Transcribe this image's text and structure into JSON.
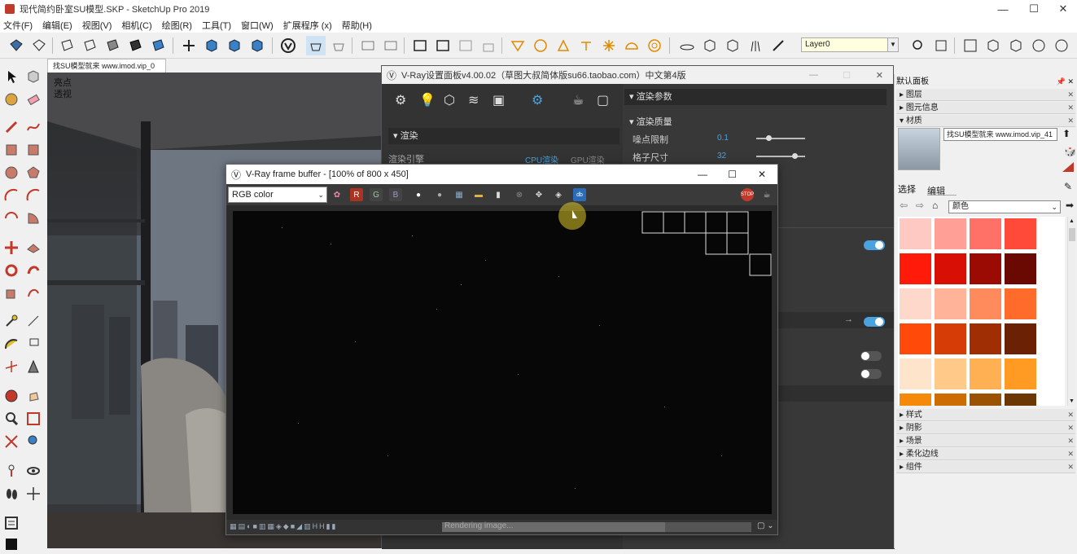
{
  "window": {
    "title": "现代简约卧室SU模型.SKP - SketchUp Pro 2019"
  },
  "menu": [
    "文件(F)",
    "编辑(E)",
    "视图(V)",
    "相机(C)",
    "绘图(R)",
    "工具(T)",
    "窗口(W)",
    "扩展程序 (x)",
    "帮助(H)"
  ],
  "toolbar": {
    "layer": "Layer0"
  },
  "scene": {
    "tab": "找SU模型就来 www.imod.vip_0",
    "label1": "亮点",
    "label2": "透视"
  },
  "vray_settings": {
    "title": "V-Ray设置面板v4.00.02（草图大叔简体版su66.taobao.com）中文第4版",
    "render_section": "渲染",
    "render_engine_label": "渲染引擎",
    "cpu_label": "CPU渲染",
    "gpu_label": "GPU渲染",
    "render_params": "渲染参数",
    "render_quality": "渲染质量",
    "noise_limit_label": "噪点限制",
    "noise_limit_value": "0.1",
    "bucket_size_label": "格子尺寸",
    "bucket_size_value": "32"
  },
  "frame_buffer": {
    "title": "V-Ray frame buffer - [100% of 800 x 450]",
    "channel": "RGB color",
    "r": "R",
    "g": "G",
    "b": "B",
    "status": "Rendering image...",
    "progress": 0.72
  },
  "tray": {
    "title": "默认面板",
    "sections_top": [
      "图层",
      "图元信息",
      "材质"
    ],
    "material_name": "找SU模型就来 www.imod.vip_41",
    "tab_select": "选择",
    "tab_edit": "编辑",
    "color_set": "颜色",
    "swatches": [
      "#ffc9c3",
      "#ff9f96",
      "#ff7066",
      "#ff4a3a",
      "#ff1a0a",
      "#d70f05",
      "#9b0a03",
      "#6a0802",
      "#ffd8cc",
      "#ffb399",
      "#ff8a5c",
      "#ff6b2b",
      "#ff4a0a",
      "#d63c05",
      "#a02e05",
      "#6b2104",
      "#ffe4cc",
      "#ffc98a",
      "#ffb052",
      "#ff9a23",
      "#f5890a",
      "#cc6c05",
      "#9c5205",
      "#6b3803"
    ],
    "sections_bottom": [
      "样式",
      "阴影",
      "场景",
      "柔化边线",
      "组件"
    ]
  },
  "colors": {
    "accent": "#4aa3df",
    "toggle_on": "#4aa3df"
  }
}
